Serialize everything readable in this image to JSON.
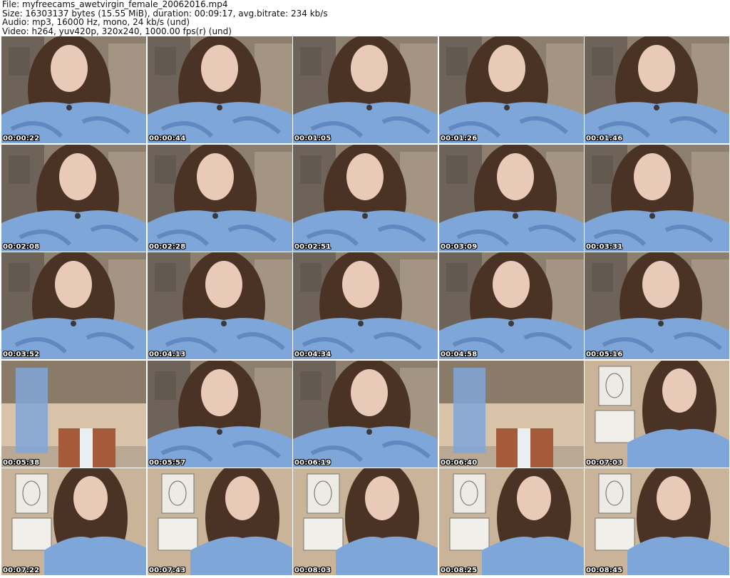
{
  "header": {
    "file": "File: myfreecams_awetvirgin_female_20062016.mp4",
    "size": "Size: 16303137 bytes (15.55 MiB), duration: 00:09:17, avg.bitrate: 234 kb/s",
    "audio": "Audio: mp3, 16000 Hz, mono, 24 kb/s (und)",
    "video": "Video: h264, yuv420p, 320x240, 1000.00 fps(r) (und)"
  },
  "thumbnails": [
    {
      "timestamp": "00:00:22",
      "scene": "portrait"
    },
    {
      "timestamp": "00:00:44",
      "scene": "portrait"
    },
    {
      "timestamp": "00:01:05",
      "scene": "portrait"
    },
    {
      "timestamp": "00:01:26",
      "scene": "portrait"
    },
    {
      "timestamp": "00:01:46",
      "scene": "portrait"
    },
    {
      "timestamp": "00:02:08",
      "scene": "portrait"
    },
    {
      "timestamp": "00:02:28",
      "scene": "portrait"
    },
    {
      "timestamp": "00:02:51",
      "scene": "portrait"
    },
    {
      "timestamp": "00:03:09",
      "scene": "portrait"
    },
    {
      "timestamp": "00:03:31",
      "scene": "portrait"
    },
    {
      "timestamp": "00:03:52",
      "scene": "portrait"
    },
    {
      "timestamp": "00:04:13",
      "scene": "portrait"
    },
    {
      "timestamp": "00:04:34",
      "scene": "portrait"
    },
    {
      "timestamp": "00:04:58",
      "scene": "portrait"
    },
    {
      "timestamp": "00:05:16",
      "scene": "portrait"
    },
    {
      "timestamp": "00:05:38",
      "scene": "room"
    },
    {
      "timestamp": "00:05:57",
      "scene": "portrait"
    },
    {
      "timestamp": "00:06:19",
      "scene": "portrait"
    },
    {
      "timestamp": "00:06:40",
      "scene": "room"
    },
    {
      "timestamp": "00:07:03",
      "scene": "drawings"
    },
    {
      "timestamp": "00:07:22",
      "scene": "drawings"
    },
    {
      "timestamp": "00:07:43",
      "scene": "drawings"
    },
    {
      "timestamp": "00:08:03",
      "scene": "drawings"
    },
    {
      "timestamp": "00:08:25",
      "scene": "drawings"
    },
    {
      "timestamp": "00:08:45",
      "scene": "drawings"
    }
  ],
  "colors": {
    "blouse": "#7fa6d8",
    "blouse_dark": "#4d74b0",
    "hair": "#4a3325",
    "skin": "#e9c9b8",
    "wall": "#8c7f70",
    "room_wall": "#b9a894"
  }
}
